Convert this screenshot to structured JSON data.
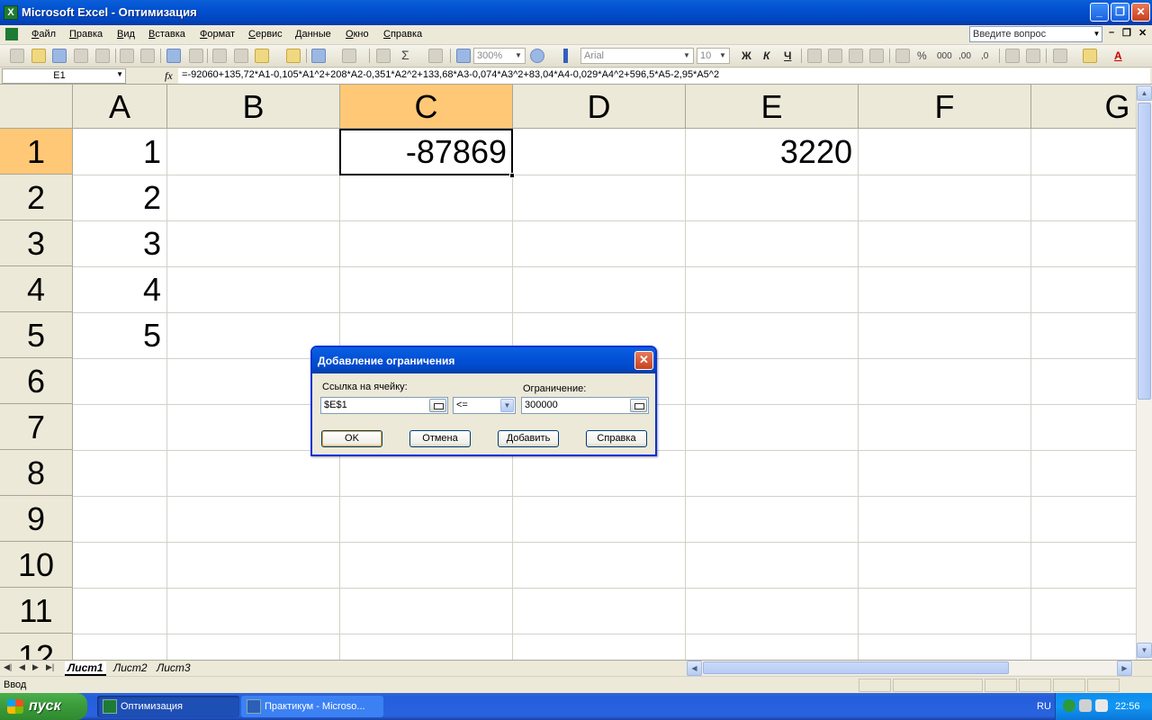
{
  "window": {
    "title": "Microsoft Excel - Оптимизация",
    "app_icon": "X"
  },
  "menu": [
    "Файл",
    "Правка",
    "Вид",
    "Вставка",
    "Формат",
    "Сервис",
    "Данные",
    "Окно",
    "Справка"
  ],
  "help_box": {
    "placeholder": "Введите вопрос"
  },
  "toolbar": {
    "zoom": "300%",
    "font_name": "Arial",
    "font_size": "10",
    "bold": "Ж",
    "italic": "К",
    "underline": "Ч",
    "sum": "Σ",
    "percent": "%",
    "thousands": "000",
    "inc_decimal": ",00",
    "dec_decimal": ",0"
  },
  "formula_bar": {
    "name_box": "E1",
    "fx": "fx",
    "formula": "=-92060+135,72*A1-0,105*A1^2+208*A2-0,351*A2^2+133,68*A3-0,074*A3^2+83,04*A4-0,029*A4^2+596,5*A5-2,95*A5^2"
  },
  "sheet": {
    "columns": [
      "A",
      "B",
      "C",
      "D",
      "E",
      "F",
      "G"
    ],
    "active_column": "C",
    "rows": [
      "1",
      "2",
      "3",
      "4",
      "5",
      "6",
      "7",
      "8",
      "9",
      "10",
      "11",
      "12"
    ],
    "active_row": "1",
    "cells": {
      "A1": "1",
      "A2": "2",
      "A3": "3",
      "A4": "4",
      "A5": "5",
      "C1": "-87869",
      "E1": "3220"
    }
  },
  "sheet_tabs": [
    "Лист1",
    "Лист2",
    "Лист3"
  ],
  "status": "Ввод",
  "dialog": {
    "title": "Добавление ограничения",
    "cell_ref_label": "Ссылка на ячейку:",
    "cell_ref_value": "$E$1",
    "operator_value": "<=",
    "constraint_label": "Ограничение:",
    "constraint_value": "300000",
    "buttons": {
      "ok": "OK",
      "cancel": "Отмена",
      "add": "Добавить",
      "help": "Справка"
    }
  },
  "taskbar": {
    "start": "пуск",
    "tasks": [
      "Оптимизация",
      "Практикум - Microso..."
    ],
    "language": "RU",
    "clock": "22:56"
  },
  "colors": {
    "selection_header": "#ffc876",
    "title_blue": "#0250d0",
    "start_green": "#3a9a3a"
  }
}
